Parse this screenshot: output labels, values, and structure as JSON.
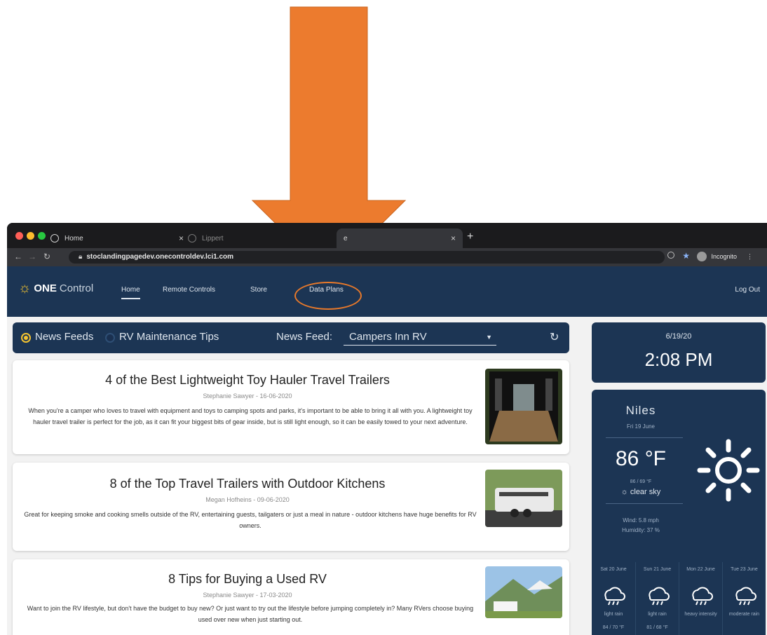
{
  "browser": {
    "tabs": [
      {
        "label": "Home"
      },
      {
        "label": "Lippert"
      },
      {
        "label": "e"
      }
    ],
    "url_host": "stoclandingpagedev.onecontroldev.lci1.com",
    "profile_label": "Incognito"
  },
  "app": {
    "logo_bold": "ONE",
    "logo_light": "Control",
    "nav": {
      "home": "Home",
      "remote_controls": "Remote Controls",
      "store": "Store",
      "data_plans": "Data Plans",
      "log_out": "Log Out"
    }
  },
  "filter": {
    "news_feeds_label": "News Feeds",
    "rv_tips_label": "RV Maintenance Tips",
    "selected": "News Feeds",
    "feed_label": "News Feed:",
    "feed_value": "Campers Inn RV"
  },
  "articles": [
    {
      "title": "4 of the Best Lightweight Toy Hauler Travel Trailers",
      "meta": "Stephanie Sawyer - 16-06-2020",
      "excerpt": "When you're a camper who loves to travel with equipment and toys to camping spots and parks, it's important to be able to bring it all with you. A lightweight toy hauler travel trailer is perfect for the job, as it can fit your biggest bits of gear inside, but is still light enough, so it can be easily towed to your next adventure."
    },
    {
      "title": "8 of the Top Travel Trailers with Outdoor Kitchens",
      "meta": "Megan Hofheins - 09-06-2020",
      "excerpt": "Great for keeping smoke and cooking smells outside of the RV, entertaining guests, tailgaters or just a meal in nature - outdoor kitchens have huge benefits for RV owners."
    },
    {
      "title": "8 Tips for Buying a Used RV",
      "meta": "Stephanie Sawyer - 17-03-2020",
      "excerpt": "Want to join the RV lifestyle, but don't have the budget to buy new? Or just want to try out the lifestyle before jumping completely in? Many RVers choose buying used over new when just starting out."
    }
  ],
  "clock": {
    "date": "6/19/20",
    "time": "2:08 PM"
  },
  "weather": {
    "city": "Niles",
    "day": "Fri 19 June",
    "temp": "86 °F",
    "range": "86 / 69 °F",
    "condition": "clear sky",
    "wind": "Wind: 5.8 mph",
    "humidity": "Humidity: 37 %",
    "forecast": [
      {
        "day": "Sat 20 June",
        "condition": "light rain",
        "range": "84 / 70 °F"
      },
      {
        "day": "Sun 21 June",
        "condition": "light rain",
        "range": "81 / 68 °F"
      },
      {
        "day": "Mon 22 June",
        "condition": "heavy intensity",
        "range": ""
      },
      {
        "day": "Tue 23 June",
        "condition": "moderate rain",
        "range": ""
      }
    ]
  },
  "colors": {
    "navy": "#1c3554",
    "accent_orange": "#e8792a",
    "sun_yellow": "#f4c430"
  }
}
